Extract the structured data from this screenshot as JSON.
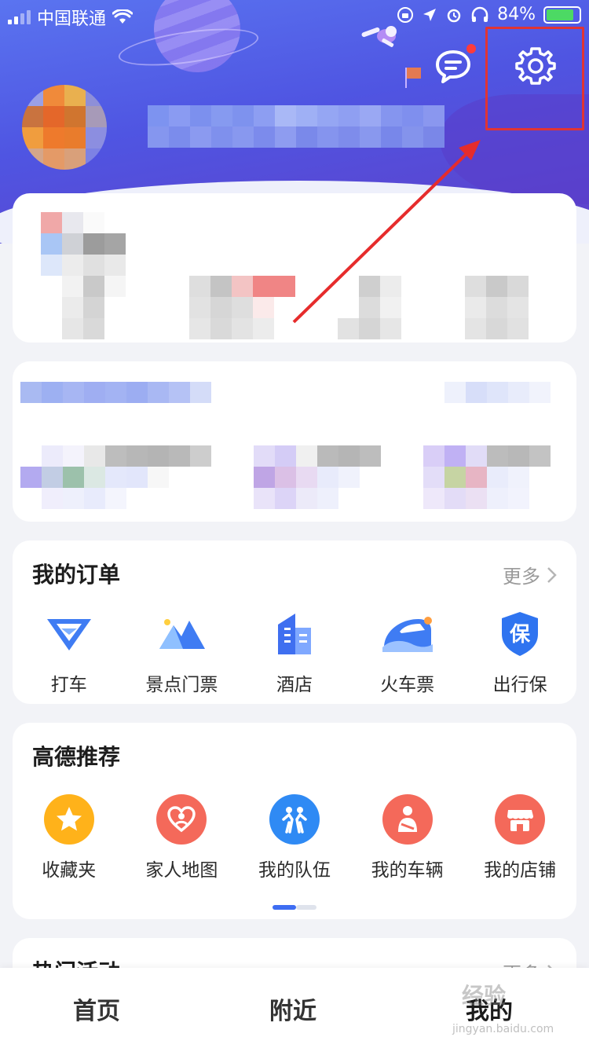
{
  "status_bar": {
    "carrier": "中国联通",
    "battery": "84%",
    "battery_level": 0.84
  },
  "header": {
    "message_icon": "message-bubble-icon",
    "settings_icon": "gear-icon",
    "has_unread_dot": true
  },
  "orders": {
    "title": "我的订单",
    "more_label": "更多",
    "items": [
      {
        "label": "打车",
        "icon": "taxi-icon"
      },
      {
        "label": "景点门票",
        "icon": "mountain-icon"
      },
      {
        "label": "酒店",
        "icon": "hotel-building-icon"
      },
      {
        "label": "火车票",
        "icon": "train-icon"
      },
      {
        "label": "出行保",
        "icon": "insurance-shield-icon",
        "glyph": "保"
      }
    ]
  },
  "recommend": {
    "title": "高德推荐",
    "items": [
      {
        "label": "收藏夹",
        "icon": "star-icon"
      },
      {
        "label": "家人地图",
        "icon": "family-heart-icon"
      },
      {
        "label": "我的队伍",
        "icon": "team-icon"
      },
      {
        "label": "我的车辆",
        "icon": "driver-icon"
      },
      {
        "label": "我的店铺",
        "icon": "shop-icon"
      }
    ],
    "page": 1,
    "page_count": 2
  },
  "activities": {
    "title": "热门活动",
    "more_label": "更多"
  },
  "tabbar": {
    "tabs": [
      {
        "label": "首页"
      },
      {
        "label": "附近"
      },
      {
        "label": "我的"
      }
    ],
    "active_index": 2
  },
  "watermark": {
    "text": "经验",
    "sub": "jingyan.baidu.com"
  },
  "colors": {
    "accent": "#3e6df2",
    "highlight": "#e03434",
    "header_start": "#5a74f0",
    "header_end": "#5f3fc9"
  }
}
